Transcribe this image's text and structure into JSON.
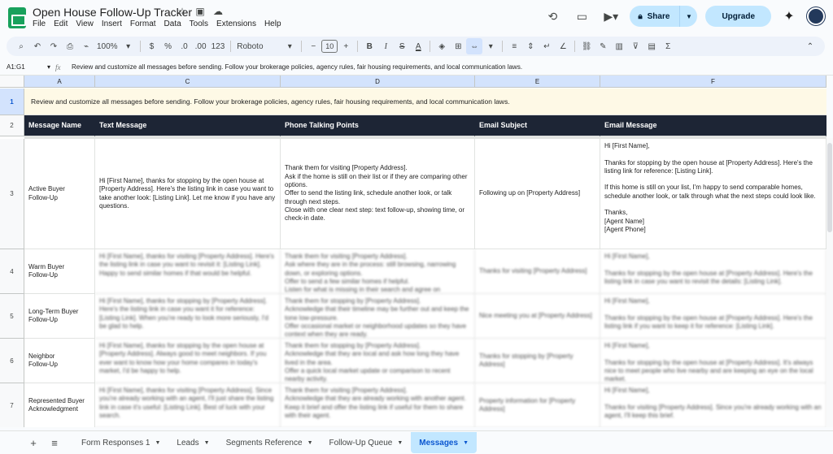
{
  "header": {
    "doc_title": "Open House Follow-Up Tracker",
    "menu": [
      "File",
      "Edit",
      "View",
      "Insert",
      "Format",
      "Data",
      "Tools",
      "Extensions",
      "Help"
    ],
    "share_label": "Share",
    "upgrade_label": "Upgrade"
  },
  "toolbar": {
    "zoom": "100%",
    "currency": "$",
    "percent": "%",
    "decimal_decrease": ".0",
    "decimal_increase": ".00",
    "number_format": "123",
    "font": "Roboto",
    "font_size": "10",
    "bold": "B",
    "italic": "I",
    "strike": "S",
    "text_color": "A"
  },
  "formula_bar": {
    "cell_ref": "A1:G1",
    "fx": "fx",
    "content": "Review and customize all messages before sending. Follow your brokerage policies, agency rules, fair housing requirements, and local communication laws."
  },
  "grid": {
    "column_headers": [
      "A",
      "C",
      "D",
      "E",
      "F"
    ],
    "row_numbers": [
      "1",
      "2",
      "3",
      "4",
      "5",
      "6",
      "7"
    ],
    "banner": "Review and customize all messages before sending. Follow your brokerage policies, agency rules, fair housing requirements, and local communication laws.",
    "table_headers": [
      "Message Name",
      "Text Message",
      "Phone Talking Points",
      "Email Subject",
      "Email Message"
    ],
    "rows": [
      {
        "name": "Active Buyer\nFollow-Up",
        "text": "Hi [First Name], thanks for stopping by the open house at [Property Address]. Here's the listing link in case you want to take another look: [Listing Link]. Let me know if you have any questions.",
        "phone": "Thank them for visiting [Property Address].\nAsk if the home is still on their list or if they are comparing other options.\nOffer to send the listing link, schedule another look, or talk through next steps.\nClose with one clear next step: text follow-up, showing time, or check-in date.",
        "subject": "Following up on [Property Address]",
        "email": "Hi [First Name],\n\nThanks for stopping by the open house at [Property Address]. Here's the listing link for reference: [Listing Link].\n\nIf this home is still on your list, I'm happy to send comparable homes, schedule another look, or talk through what the next steps could look like.\n\nThanks,\n[Agent Name]\n[Agent Phone]"
      },
      {
        "name": "Warm Buyer\nFollow-Up",
        "text": "Hi [First Name], thanks for visiting [Property Address]. Here's the listing link in case you want to revisit it: [Listing Link]. Happy to send similar homes if that would be helpful.",
        "phone": "Thank them for visiting [Property Address].\nAsk where they are in the process: still browsing, narrowing down, or exploring options.\nOffer to send a few similar homes if helpful.\nListen for what is missing in their search and agree on",
        "subject": "Thanks for visiting [Property Address]",
        "email": "Hi [First Name],\n\nThanks for stopping by the open house at [Property Address]. Here's the listing link in case you want to revisit the details: [Listing Link]."
      },
      {
        "name": "Long-Term Buyer\nFollow-Up",
        "text": "Hi [First Name], thanks for stopping by [Property Address]. Here's the listing link in case you want it for reference: [Listing Link]. When you're ready to look more seriously, I'd be glad to help.",
        "phone": "Thank them for stopping by [Property Address].\nAcknowledge that their timeline may be further out and keep the tone low-pressure.\nOffer occasional market or neighborhood updates so they have context when they are ready.",
        "subject": "Nice meeting you at [Property Address]",
        "email": "Hi [First Name],\n\nThanks for stopping by the open house at [Property Address]. Here's the listing link if you want to keep it for reference: [Listing Link]."
      },
      {
        "name": "Neighbor\nFollow-Up",
        "text": "Hi [First Name], thanks for stopping by the open house at [Property Address]. Always good to meet neighbors. If you ever want to know how your home compares in today's market, I'd be happy to help.",
        "phone": "Thank them for stopping by [Property Address].\nAcknowledge that they are local and ask how long they have lived in the area.\nOffer a quick local market update or comparison to recent nearby activity.",
        "subject": "Thanks for stopping by [Property Address]",
        "email": "Hi [First Name],\n\nThanks for stopping by the open house at [Property Address]. It's always nice to meet people who live nearby and are keeping an eye on the local market."
      },
      {
        "name": "Represented Buyer\nAcknowledgment",
        "text": "Hi [First Name], thanks for visiting [Property Address]. Since you're already working with an agent, I'll just share the listing link in case it's useful: [Listing Link]. Best of luck with your search.",
        "phone": "Thank them for visiting [Property Address].\nAcknowledge that they are already working with another agent.\nKeep it brief and offer the listing link if useful for them to share with their agent.",
        "subject": "Property information for [Property Address]",
        "email": "Hi [First Name],\n\nThanks for visiting [Property Address]. Since you're already working with an agent, I'll keep this brief."
      }
    ]
  },
  "tabs": {
    "sheets": [
      "Form Responses 1",
      "Leads",
      "Segments Reference",
      "Follow-Up Queue",
      "Messages"
    ],
    "active": "Messages"
  },
  "colors": {
    "header_row_bg": "#1d2535",
    "banner_bg": "#fef9e6",
    "share_bg": "#c2e7ff",
    "active_tab_text": "#0b57d0"
  }
}
